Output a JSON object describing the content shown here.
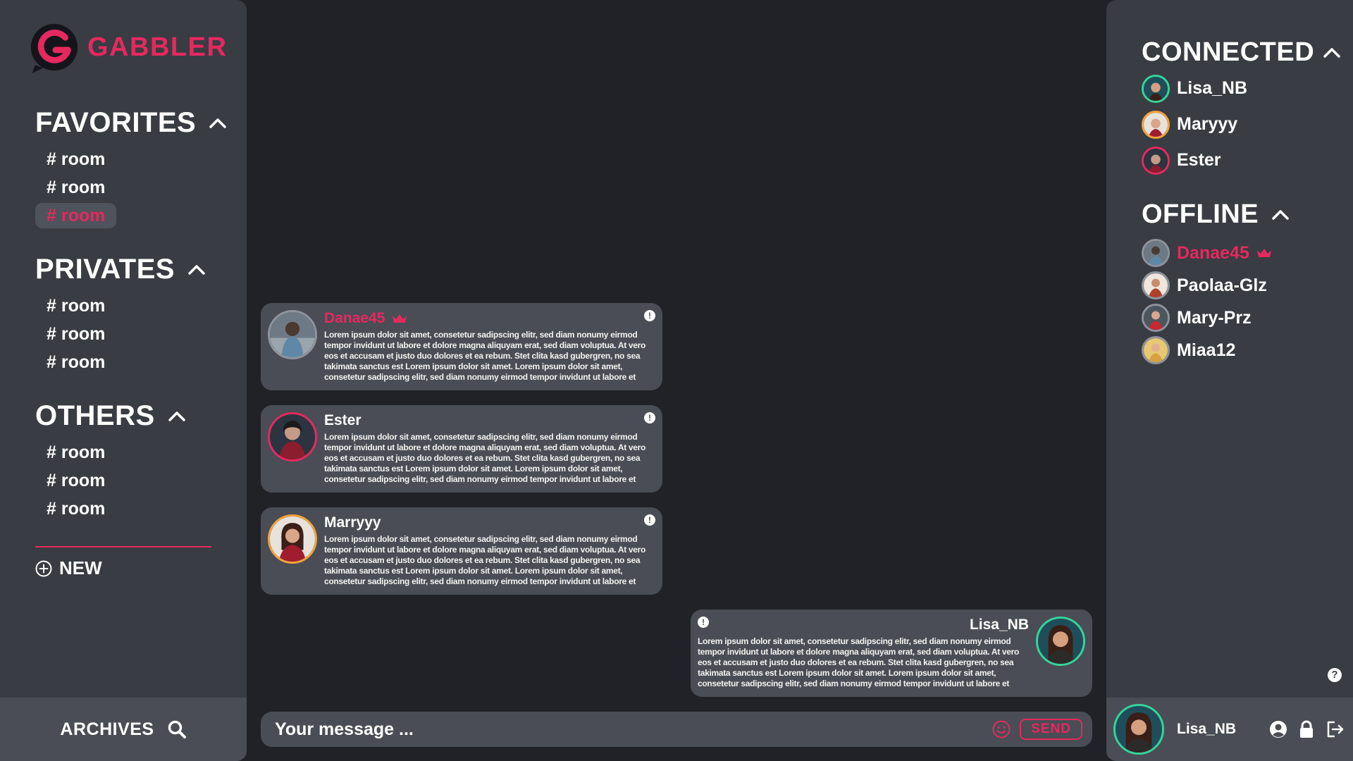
{
  "app": {
    "brand_name": "GABBLER",
    "accent_color": "#e5295f",
    "online_color": "#35d49b"
  },
  "sidebar": {
    "sections": [
      {
        "title": "FAVORITES",
        "rooms": [
          "# room",
          "# room",
          "# room"
        ],
        "active_index": 2
      },
      {
        "title": "PRIVATES",
        "rooms": [
          "# room",
          "# room",
          "# room"
        ]
      },
      {
        "title": "OTHERS",
        "rooms": [
          "# room",
          "# room",
          "# room"
        ]
      }
    ],
    "new_label": "NEW",
    "archives_label": "ARCHIVES"
  },
  "messages": [
    {
      "author": "Danae45",
      "admin": true,
      "text": "Lorem ipsum dolor sit amet, consetetur sadipscing elitr, sed diam nonumy eirmod tempor invidunt ut labore et dolore magna aliquyam erat, sed diam voluptua. At vero eos et accusam et justo duo dolores et ea rebum. Stet clita kasd gubergren, no sea takimata sanctus est Lorem ipsum dolor sit amet. Lorem ipsum dolor sit amet, consetetur sadipscing elitr, sed diam nonumy eirmod tempor invidunt ut labore et",
      "info": "!"
    },
    {
      "author": "Ester",
      "text": "Lorem ipsum dolor sit amet, consetetur sadipscing elitr, sed diam nonumy eirmod tempor invidunt ut labore et dolore magna aliquyam erat, sed diam voluptua. At vero eos et accusam et justo duo dolores et ea rebum. Stet clita kasd gubergren, no sea takimata sanctus est Lorem ipsum dolor sit amet. Lorem ipsum dolor sit amet, consetetur sadipscing elitr, sed diam nonumy eirmod tempor invidunt ut labore et",
      "info": "!"
    },
    {
      "author": "Marryyy",
      "text": "Lorem ipsum dolor sit amet, consetetur sadipscing elitr, sed diam nonumy eirmod tempor invidunt ut labore et dolore magna aliquyam erat, sed diam voluptua. At vero eos et accusam et justo duo dolores et ea rebum. Stet clita kasd gubergren, no sea takimata sanctus est Lorem ipsum dolor sit amet. Lorem ipsum dolor sit amet, consetetur sadipscing elitr, sed diam nonumy eirmod tempor invidunt ut labore et",
      "info": "!"
    },
    {
      "author": "Lisa_NB",
      "own": true,
      "text": "Lorem ipsum dolor sit amet, consetetur sadipscing elitr, sed diam nonumy eirmod tempor invidunt ut labore et dolore magna aliquyam erat, sed diam voluptua. At vero eos et accusam et justo duo dolores et ea rebum. Stet clita kasd gubergren, no sea takimata sanctus est Lorem ipsum dolor sit amet. Lorem ipsum dolor sit amet, consetetur sadipscing elitr, sed diam nonumy eirmod tempor invidunt ut labore et",
      "info": "!"
    }
  ],
  "composer": {
    "placeholder": "Your message ...",
    "send_label": "SEND"
  },
  "users": {
    "connected_title": "CONNECTED",
    "connected": [
      "Lisa_NB",
      "Maryyy",
      "Ester"
    ],
    "offline_title": "OFFLINE",
    "offline": [
      "Danae45",
      "Paolaa-Glz",
      "Mary-Prz",
      "Miaa12"
    ]
  },
  "help_symbol": "?",
  "profile": {
    "username": "Lisa_NB"
  }
}
